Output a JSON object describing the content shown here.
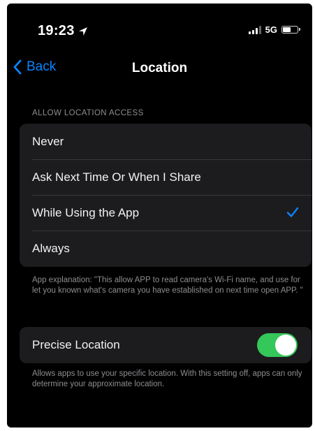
{
  "status_bar": {
    "time": "19:23",
    "location_icon": "location-arrow-icon",
    "network": "5G",
    "battery_level": 0.6
  },
  "nav": {
    "back_label": "Back",
    "title": "Location"
  },
  "location_access": {
    "header": "ALLOW LOCATION ACCESS",
    "options": [
      {
        "label": "Never",
        "selected": false
      },
      {
        "label": "Ask Next Time Or When I Share",
        "selected": false
      },
      {
        "label": "While Using the App",
        "selected": true
      },
      {
        "label": "Always",
        "selected": false
      }
    ],
    "explanation": "App explanation: \"This allow APP to read camera's Wi-Fi name, and use for let you known what's camera you have established on next time open APP. \""
  },
  "precise_location": {
    "label": "Precise Location",
    "enabled": true,
    "description": "Allows apps to use your specific location. With this setting off, apps can only determine your approximate location."
  },
  "colors": {
    "background": "#000000",
    "cell": "#1c1c1e",
    "accent": "#0a84ff",
    "toggle_on": "#34c759",
    "secondary_text": "#8e8e93"
  }
}
